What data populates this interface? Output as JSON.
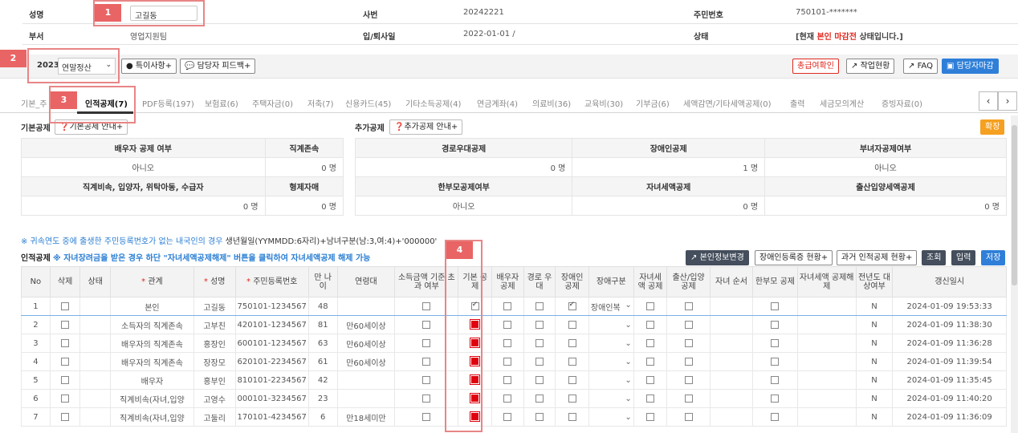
{
  "info": {
    "row1": {
      "name_label": "성명",
      "name_value": "고길동",
      "empno_label": "사번",
      "empno_value": "20242221",
      "ssn_label": "주민번호",
      "ssn_value": "750101-*******"
    },
    "row2": {
      "dept_label": "부서",
      "dept_value": "영업지원팀",
      "hire_label": "입/퇴사일",
      "hire_value": "2022-01-01 /",
      "status_label": "상태",
      "status_prefix": "[현재",
      "status_red": "본인 마감전",
      "status_suffix": "상태입니다.]"
    }
  },
  "callouts": [
    "1",
    "2",
    "3",
    "4"
  ],
  "toolbar": {
    "year": "2023",
    "type_select": "연말정산",
    "special_btn": "특이사항+",
    "feedback_btn": "담당자 피드백+",
    "refund_btn": "총급여확인",
    "work_btn": "작업현황",
    "faq_btn": "FAQ",
    "close_btn": "담당자마감"
  },
  "tabs": [
    "기본_주",
    "인적공제(7)",
    "PDF등록(197)",
    "보험료(6)",
    "주택자금(0)",
    "저축(7)",
    "신용카드(45)",
    "기타소득공제(4)",
    "연금계좌(4)",
    "의료비(36)",
    "교육비(30)",
    "기부금(6)",
    "세액감면/기타세액공제(0)",
    "출력",
    "세금모의계산",
    "증빙자료(0)"
  ],
  "nav": {
    "prev": "‹",
    "next": "›"
  },
  "basic": {
    "title": "기본공제",
    "guide_btn": "기본공제 안내+",
    "h1": "배우자 공제 여부",
    "h2": "직계존속",
    "v1": "아니오",
    "v2": "0 명",
    "h3": "직계비속, 입양자, 위탁아동, 수급자",
    "h4": "형제자매",
    "v3": "0 명",
    "v4": "0 명"
  },
  "extra": {
    "title": "추가공제",
    "guide_btn": "추가공제 안내+",
    "expand_btn": "확장",
    "h1": "경로우대공제",
    "h2": "장애인공제",
    "h3": "부녀자공제여부",
    "v1": "0 명",
    "v2": "1 명",
    "v3": "아니오",
    "h4": "한부모공제여부",
    "h5": "자녀세액공제",
    "h6": "출산입양세액공제",
    "v4": "아니오",
    "v5": "0 명",
    "v6": "0 명"
  },
  "notes": {
    "n1_blue": "※ 귀속연도 중에 출생한 주민등록번호가 없는 내국인의 경우",
    "n1_rest": "생년월일(YYMMDD:6자리)+남녀구분(남:3,여:4)+'000000'",
    "n2_bold": "인적공제",
    "n2_blue": "※ 자녀장려금을 받은 경우 하단 \"자녀세액공제해제\" 버튼을 클릭하여 자녀세액공제 해제 가능"
  },
  "actions": {
    "change_btn": "본인정보변경",
    "disabled_btn": "장애인등록증 현황+",
    "past_btn": "과거 인적공제 현황+",
    "query_btn": "조회",
    "input_btn": "입력",
    "save_btn": "저장"
  },
  "table": {
    "headers": [
      "No",
      "삭제",
      "상태",
      "관계",
      "성명",
      "주민등록번호",
      "만 나이",
      "연령대",
      "소득금액 기준 초과 여부",
      "기본 공제",
      "배우자 공제",
      "경로 우대",
      "장애인 공제",
      "장애구분",
      "자녀세액 공제",
      "출산/입양 공제",
      "자녀 순서",
      "한부모 공제",
      "자녀세액 공제해제",
      "전년도 대상여부",
      "갱신일시"
    ],
    "rows": [
      {
        "no": "1",
        "rel": "본인",
        "name": "고길동",
        "ssn": "750101-1234567",
        "age": "48",
        "agegrp": "",
        "basic": "check",
        "disabled": true,
        "dtype": "장애인복",
        "prev": "N",
        "updated": "2024-01-09 19:53:33"
      },
      {
        "no": "2",
        "rel": "소득자의 직계존속",
        "name": "고부친",
        "ssn": "420101-1234567",
        "age": "81",
        "agegrp": "만60세이상",
        "basic": "red",
        "disabled": false,
        "dtype": "",
        "prev": "N",
        "updated": "2024-01-09 11:38:30"
      },
      {
        "no": "3",
        "rel": "배우자의 직계존속",
        "name": "홍장인",
        "ssn": "600101-1234567",
        "age": "63",
        "agegrp": "만60세이상",
        "basic": "red",
        "disabled": false,
        "dtype": "",
        "prev": "N",
        "updated": "2024-01-09 11:36:28"
      },
      {
        "no": "4",
        "rel": "배우자의 직계존속",
        "name": "장장모",
        "ssn": "620101-2234567",
        "age": "61",
        "agegrp": "만60세이상",
        "basic": "red",
        "disabled": false,
        "dtype": "",
        "prev": "N",
        "updated": "2024-01-09 11:39:54"
      },
      {
        "no": "5",
        "rel": "배우자",
        "name": "홍부인",
        "ssn": "810101-2234567",
        "age": "42",
        "agegrp": "",
        "basic": "red",
        "disabled": false,
        "dtype": "",
        "prev": "N",
        "updated": "2024-01-09 11:35:45"
      },
      {
        "no": "6",
        "rel": "직계비속(자녀,입양",
        "name": "고영수",
        "ssn": "000101-3234567",
        "age": "23",
        "agegrp": "",
        "basic": "red",
        "disabled": false,
        "dtype": "",
        "prev": "N",
        "updated": "2024-01-09 11:40:20"
      },
      {
        "no": "7",
        "rel": "직계비속(자녀,입양",
        "name": "고둘리",
        "ssn": "170101-4234567",
        "age": "6",
        "agegrp": "만18세미만",
        "basic": "red",
        "disabled": false,
        "dtype": "",
        "prev": "N",
        "updated": "2024-01-09 11:36:09"
      }
    ]
  },
  "colors": {
    "accent": "#2f7fd8",
    "callout": "#e96464",
    "red": "#e0000f",
    "orange": "#f5a020"
  }
}
